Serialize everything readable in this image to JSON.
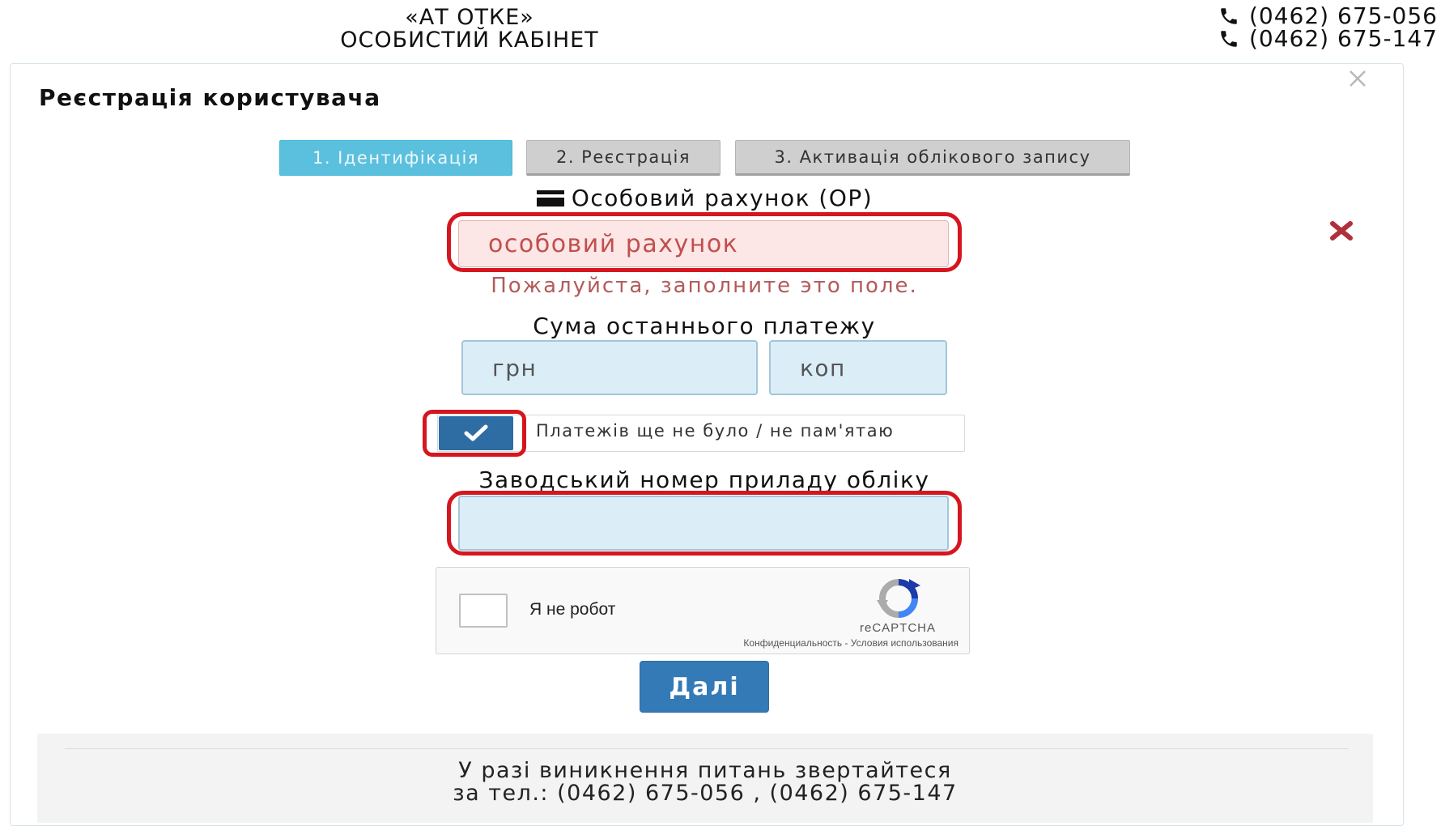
{
  "header": {
    "org_name": "«АТ ОТКЕ»",
    "cabinet_title": "ОСОБИСТИЙ КАБІНЕТ",
    "phones": [
      "(0462) 675-056",
      "(0462) 675-147"
    ]
  },
  "modal": {
    "title": "Реєстрація користувача",
    "steps": [
      {
        "label": "1. Ідентифікація",
        "active": true
      },
      {
        "label": "2. Реєстрація",
        "active": false
      },
      {
        "label": "3. Активація облікового запису",
        "active": false
      }
    ],
    "account": {
      "label": "Особовий рахунок (ОР)",
      "placeholder": "особовий рахунок",
      "error": "Пожалуйста, заполните это поле."
    },
    "last_payment": {
      "label": "Сума останнього платежу",
      "uah_placeholder": "грн",
      "kop_placeholder": "коп"
    },
    "no_payments": {
      "label": "Платежів ще не було / не пам'ятаю",
      "checked": true
    },
    "meter": {
      "label": "Заводський номер приладу обліку",
      "value": ""
    },
    "captcha": {
      "label": "Я не робот",
      "brand": "reCAPTCHA",
      "terms": "Конфиденциальность - Условия использования"
    },
    "next_button": "Далі",
    "footer": {
      "line1": "У разі виникнення питань звертайтеся",
      "line2": "за тел.: (0462) 675-056 , (0462) 675-147"
    }
  },
  "colors": {
    "active_step": "#5bc0de",
    "inactive_step": "#cfcfcf",
    "primary": "#337ab7",
    "error": "#c0504d",
    "highlight": "#d6161f",
    "input_bg": "#dbeef8"
  },
  "icons": {
    "phone": "phone-icon",
    "card": "credit-card-icon",
    "close": "close-icon",
    "error": "error-x-icon",
    "check": "checkmark-icon",
    "captcha": "recaptcha-logo-icon"
  }
}
